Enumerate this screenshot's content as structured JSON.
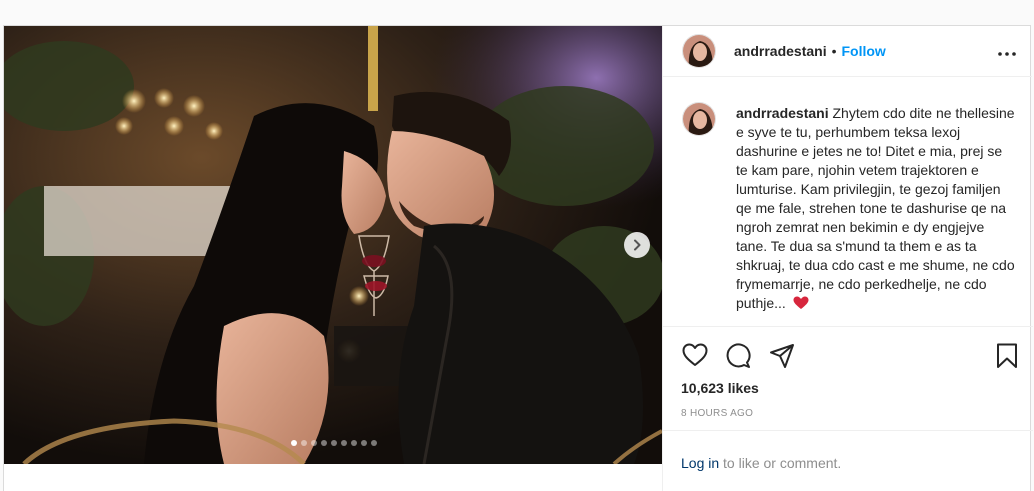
{
  "post": {
    "username": "andrradestani",
    "separator": "•",
    "follow_label": "Follow",
    "caption_text": "Zhytem cdo dite ne thellesine e syve te tu, perhumbem teksa lexoj dashurine e jetes ne to! Ditet e mia, prej se te kam pare, njohin vetem trajektoren e lumturise. Kam privilegjin, te gezoj familjen qe me fale, strehen tone te dashurise qe na ngroh zemrat nen bekimin e dy engjejve tane. Te dua sa s'mund ta them e as ta shkruaj, te dua cdo cast e me shume, ne cdo frymemarrje, ne cdo perkedhelje, ne cdo puthje...",
    "likes": "10,623 likes",
    "time_ago": "8 HOURS AGO",
    "login_link": "Log in",
    "login_rest": " to like or comment."
  },
  "carousel": {
    "total_slides": 9,
    "active_index": 0
  },
  "icons": [
    "more-options-icon",
    "heart-icon",
    "comment-icon",
    "share-icon",
    "bookmark-icon",
    "next-arrow-icon",
    "heart-emoji-icon"
  ],
  "colors": {
    "follow": "#0095f6",
    "link": "#00376b",
    "muted": "#8e8e8e",
    "text": "#262626",
    "emoji_heart": "#d7263d"
  }
}
